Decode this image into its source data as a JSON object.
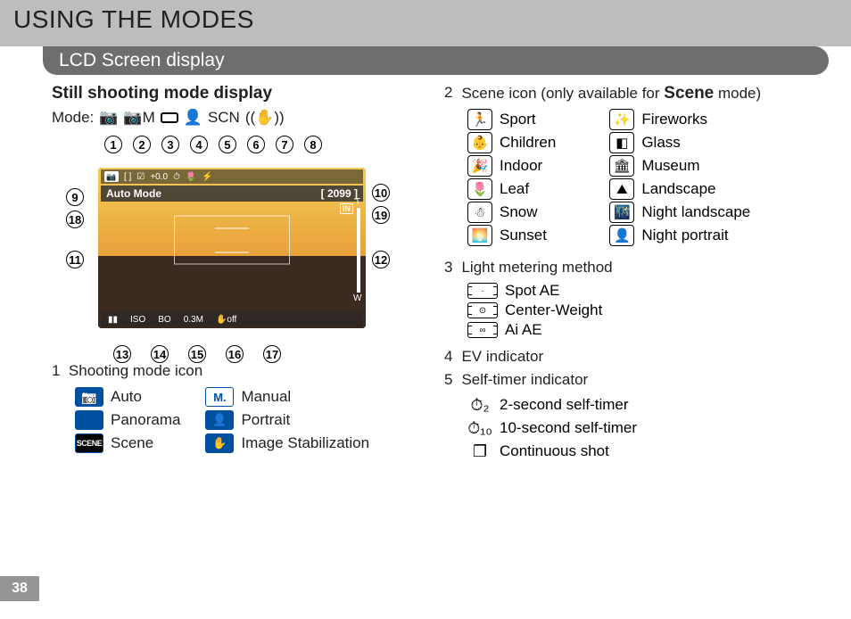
{
  "page_number": "38",
  "header": {
    "title": "USING THE MODES"
  },
  "section": {
    "title": "LCD Screen display"
  },
  "left": {
    "subheading": "Still shooting mode display",
    "mode_label": "Mode:",
    "mode_tokens": {
      "m": "M",
      "scn": "SCN"
    },
    "diagram": {
      "callouts_top": [
        "1",
        "2",
        "3",
        "4",
        "5",
        "6",
        "7",
        "8"
      ],
      "callouts_bottom": [
        "13",
        "14",
        "15",
        "16",
        "17"
      ],
      "left_9": "9",
      "left_18": "18",
      "left_11": "11",
      "right_10": "10",
      "right_19": "19",
      "right_12": "12",
      "mode_text": "Auto Mode",
      "shots_remaining": "2099",
      "in_label": "IN",
      "top_ev": "+0.0",
      "bottom_bo": "BO",
      "bottom_res": "0.3M",
      "bottom_off": "off",
      "bottom_iso": "ISO"
    },
    "legend1": {
      "title_num": "1",
      "title_text": "Shooting mode icon",
      "colA": [
        {
          "name": "auto-mode-icon",
          "label": "Auto"
        },
        {
          "name": "panorama-mode-icon",
          "label": "Panorama"
        },
        {
          "name": "scene-mode-icon",
          "label": "Scene",
          "text": "SCENE"
        }
      ],
      "colB": [
        {
          "name": "manual-mode-icon",
          "label": "Manual",
          "text": "M."
        },
        {
          "name": "portrait-mode-icon",
          "label": "Portrait",
          "glyph": "👤"
        },
        {
          "name": "stabilization-mode-icon",
          "label": "Image Stabilization",
          "glyph": "✋"
        }
      ]
    }
  },
  "right": {
    "item2": {
      "num": "2",
      "text_pre": "Scene icon (only available for ",
      "text_bold": "Scene",
      "text_post": " mode)",
      "colA": [
        {
          "name": "sport-scene-icon",
          "glyph": "🏃",
          "label": "Sport"
        },
        {
          "name": "children-scene-icon",
          "glyph": "👶",
          "label": "Children"
        },
        {
          "name": "indoor-scene-icon",
          "glyph": "🎉",
          "label": "Indoor"
        },
        {
          "name": "leaf-scene-icon",
          "glyph": "🌷",
          "label": "Leaf"
        },
        {
          "name": "snow-scene-icon",
          "glyph": "☃",
          "label": "Snow"
        },
        {
          "name": "sunset-scene-icon",
          "glyph": "🌅",
          "label": "Sunset"
        }
      ],
      "colB": [
        {
          "name": "fireworks-scene-icon",
          "glyph": "✨",
          "label": "Fireworks"
        },
        {
          "name": "glass-scene-icon",
          "glyph": "◧",
          "label": "Glass"
        },
        {
          "name": "museum-scene-icon",
          "glyph": "🏛",
          "label": "Museum"
        },
        {
          "name": "landscape-scene-icon",
          "glyph": "⛰",
          "label": "Landscape"
        },
        {
          "name": "night-landscape-scene-icon",
          "glyph": "🌃",
          "label": "Night landscape"
        },
        {
          "name": "night-portrait-scene-icon",
          "glyph": "👤",
          "label": "Night portrait"
        }
      ]
    },
    "item3": {
      "num": "3",
      "title": "Light metering method",
      "items": [
        {
          "name": "spot-ae-icon",
          "glyph": "·",
          "label": "Spot AE"
        },
        {
          "name": "center-weight-icon",
          "glyph": "⊙",
          "label": "Center-Weight"
        },
        {
          "name": "ai-ae-icon",
          "glyph": "∞",
          "label": "Ai AE"
        }
      ]
    },
    "item4": {
      "num": "4",
      "title": "EV indicator"
    },
    "item5": {
      "num": "5",
      "title": "Self-timer indicator",
      "items": [
        {
          "name": "2s-timer-icon",
          "glyph": "⏱₂",
          "label": "2-second self-timer"
        },
        {
          "name": "10s-timer-icon",
          "glyph": "⏱₁₀",
          "label": "10-second self-timer"
        },
        {
          "name": "continuous-shot-icon",
          "glyph": "❐",
          "label": "Continuous shot"
        }
      ]
    }
  }
}
